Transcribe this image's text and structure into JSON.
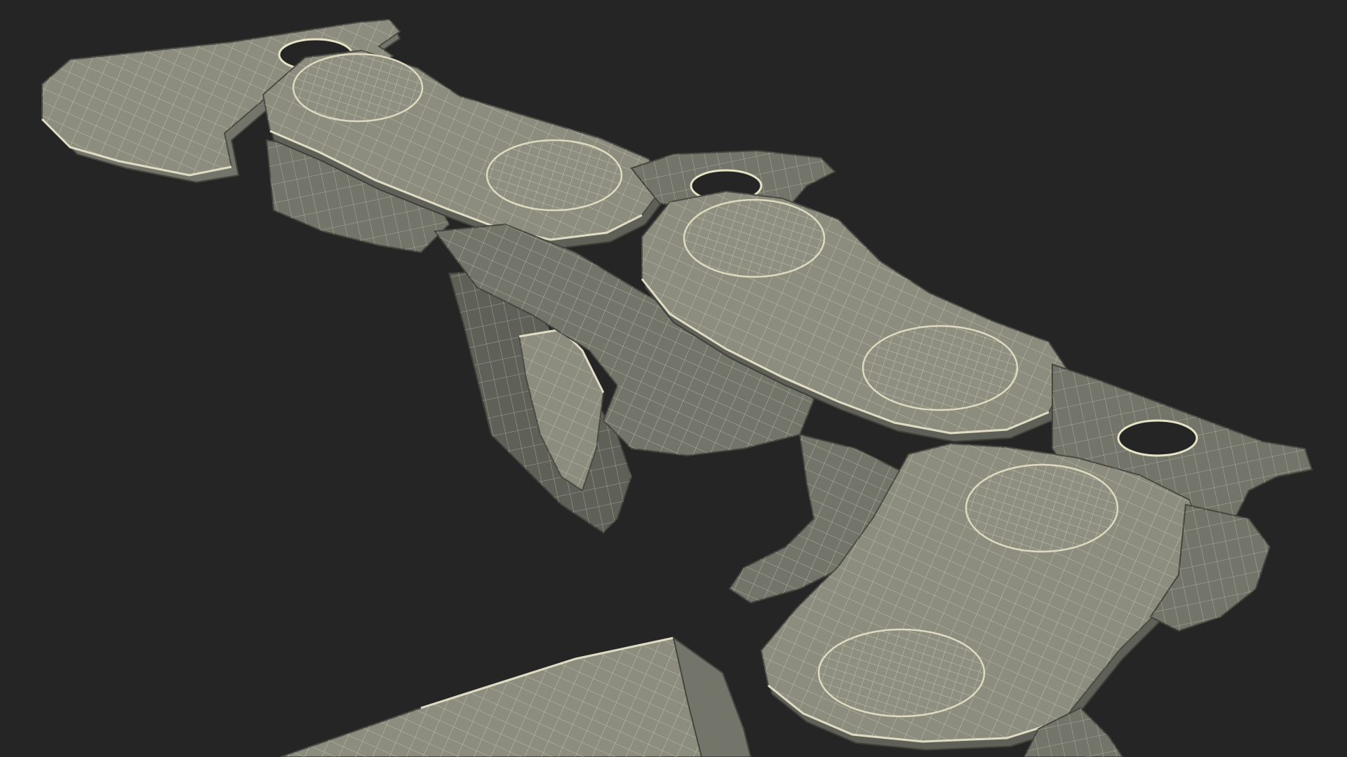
{
  "scene": {
    "description_free": true,
    "background_color": "#252525",
    "mesh_color": "#8c8d7f",
    "wire_color": "#e3dfc2",
    "mesh_dark_color": "#73746a"
  }
}
